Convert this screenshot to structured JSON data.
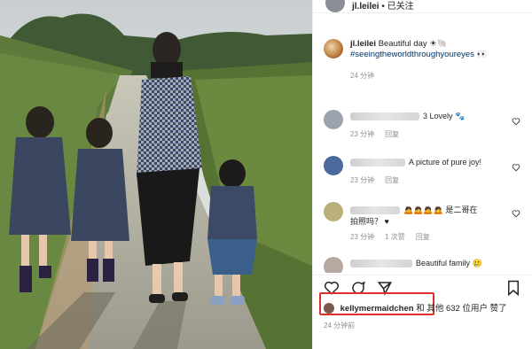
{
  "header": {
    "username": "jl.leilei",
    "separator": "•",
    "follow_status": "已关注"
  },
  "caption": {
    "username": "jl.leilei",
    "text": "Beautiful day",
    "emoji": "☀🐚",
    "hashtag": "#seeingtheworldthroughyoureyes",
    "hashtag_emoji": "👀",
    "time": "24 分钟"
  },
  "comments": [
    {
      "text": "3 Lovely",
      "emoji": "🐾",
      "time": "23 分钟",
      "reply": "回复",
      "avatar_color": "#9aa3ad"
    },
    {
      "text": "A picture of pure joy!",
      "emoji": "",
      "time": "23 分钟",
      "reply": "回复",
      "avatar_color": "#4a6b9c"
    },
    {
      "text": "是二哥在",
      "text_line2": "拍照吗？",
      "emoji": "🙇🙇🙇🙇",
      "emoji2": "♥",
      "time": "23 分钟",
      "likes": "1 次赞",
      "reply": "回复",
      "avatar_color": "#b9b07a"
    },
    {
      "text": "Beautiful family",
      "emoji": "🥲",
      "time": "",
      "reply": "",
      "avatar_color": "#b8a9a0"
    }
  ],
  "likes": {
    "username": "kellymermaidchen",
    "connector": "和",
    "rest": "其他 632 位用户 赞了"
  },
  "timestamp": "24 分钟前",
  "icons": {
    "like": "heart-icon",
    "comment": "comment-icon",
    "share": "share-icon",
    "save": "bookmark-icon"
  }
}
